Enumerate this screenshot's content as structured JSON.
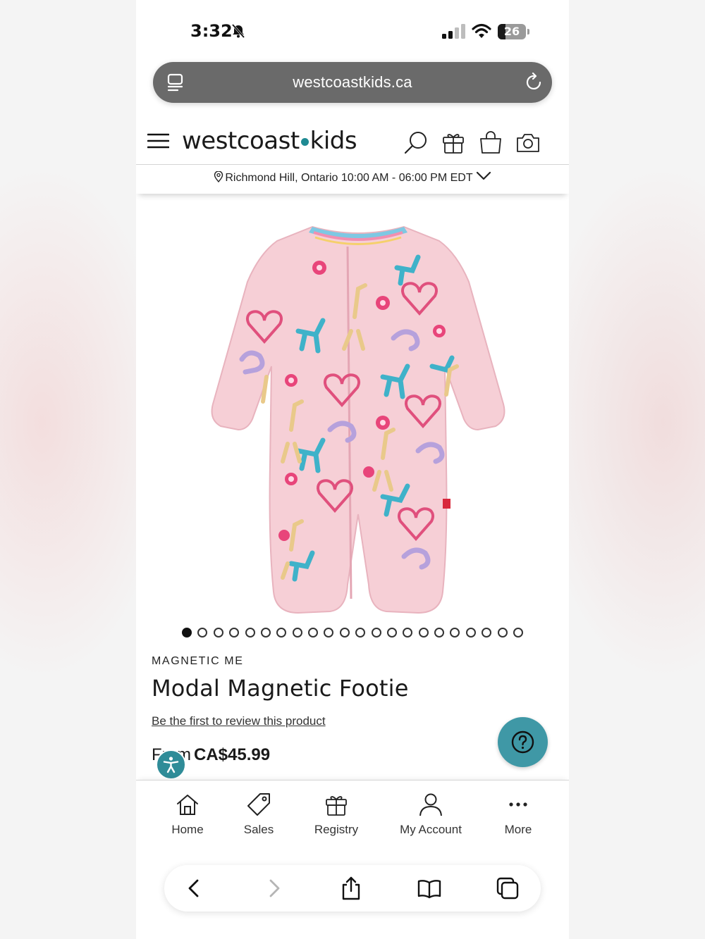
{
  "status_bar": {
    "time": "3:32",
    "battery": "26"
  },
  "browser": {
    "url": "westcoastkids.ca"
  },
  "site": {
    "logo_left": "westcoast",
    "logo_right": "kids",
    "store_info": "Richmond Hill, Ontario 10:00 AM - 06:00 PM EDT"
  },
  "carousel": {
    "total": 22,
    "active_index": 0
  },
  "product": {
    "brand": "MAGNETIC ME",
    "title": "Modal Magnetic Footie",
    "review_link": "Be the first to review this product",
    "price_prefix": "From",
    "price": "CA$45.99"
  },
  "bottom_nav": {
    "home": "Home",
    "sales": "Sales",
    "registry": "Registry",
    "account": "My Account",
    "more": "More"
  },
  "icons": {
    "header": [
      "menu-icon",
      "search-icon",
      "gift-icon",
      "bag-icon",
      "camera-icon"
    ],
    "toolbar": [
      "back-icon",
      "forward-icon",
      "share-icon",
      "bookmarks-icon",
      "tabs-icon"
    ]
  },
  "colors": {
    "accent": "#3f98a6",
    "logo_dot": "#1f8a93",
    "url_bar": "#6a6a6a",
    "product_pink": "#f6cfd6"
  }
}
